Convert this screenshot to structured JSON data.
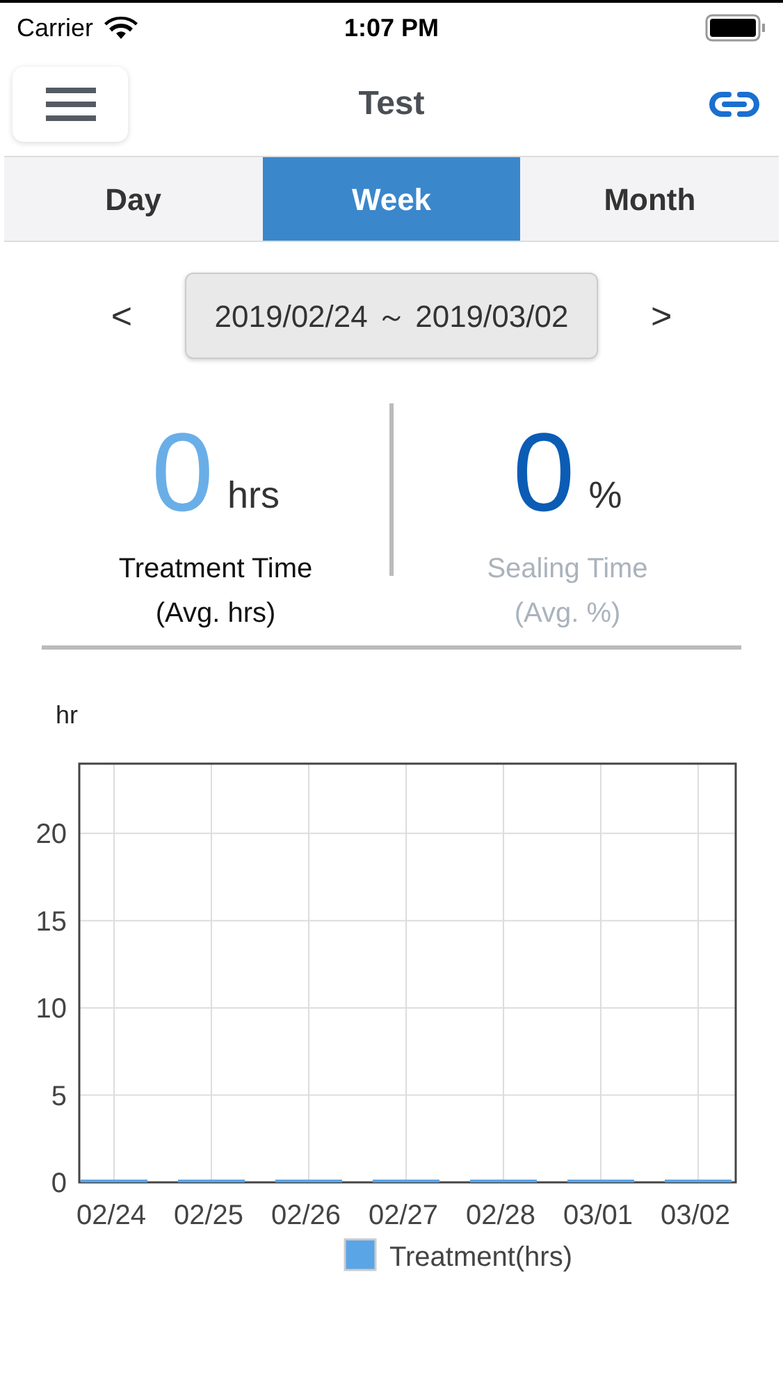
{
  "status_bar": {
    "carrier": "Carrier",
    "time": "1:07 PM"
  },
  "nav": {
    "title": "Test"
  },
  "tabs": [
    {
      "label": "Day",
      "selected": false
    },
    {
      "label": "Week",
      "selected": true
    },
    {
      "label": "Month",
      "selected": false
    }
  ],
  "date_range": {
    "prev": "<",
    "range": "2019/02/24 ～ 2019/03/02",
    "next": ">"
  },
  "stats": [
    {
      "value": "0",
      "unit": "hrs",
      "label": "Treatment Time",
      "sublabel": "(Avg. hrs)",
      "color": "#6aaee8",
      "disabled": false
    },
    {
      "value": "0",
      "unit": "%",
      "label": "Sealing Time",
      "sublabel": "(Avg. %)",
      "color": "#0b5cb5",
      "disabled": true
    }
  ],
  "chart": {
    "chart_data": {
      "type": "bar",
      "ylabel": "hr",
      "categories": [
        "02/24",
        "02/25",
        "02/26",
        "02/27",
        "02/28",
        "03/01",
        "03/02"
      ],
      "series": [
        {
          "name": "Treatment(hrs)",
          "color": "#5aa5e6",
          "values": [
            0,
            0,
            0,
            0,
            0,
            0,
            0
          ]
        }
      ],
      "ylim": [
        0,
        24
      ],
      "grid": true,
      "yticks": [
        0,
        5,
        10,
        15,
        20
      ]
    }
  }
}
